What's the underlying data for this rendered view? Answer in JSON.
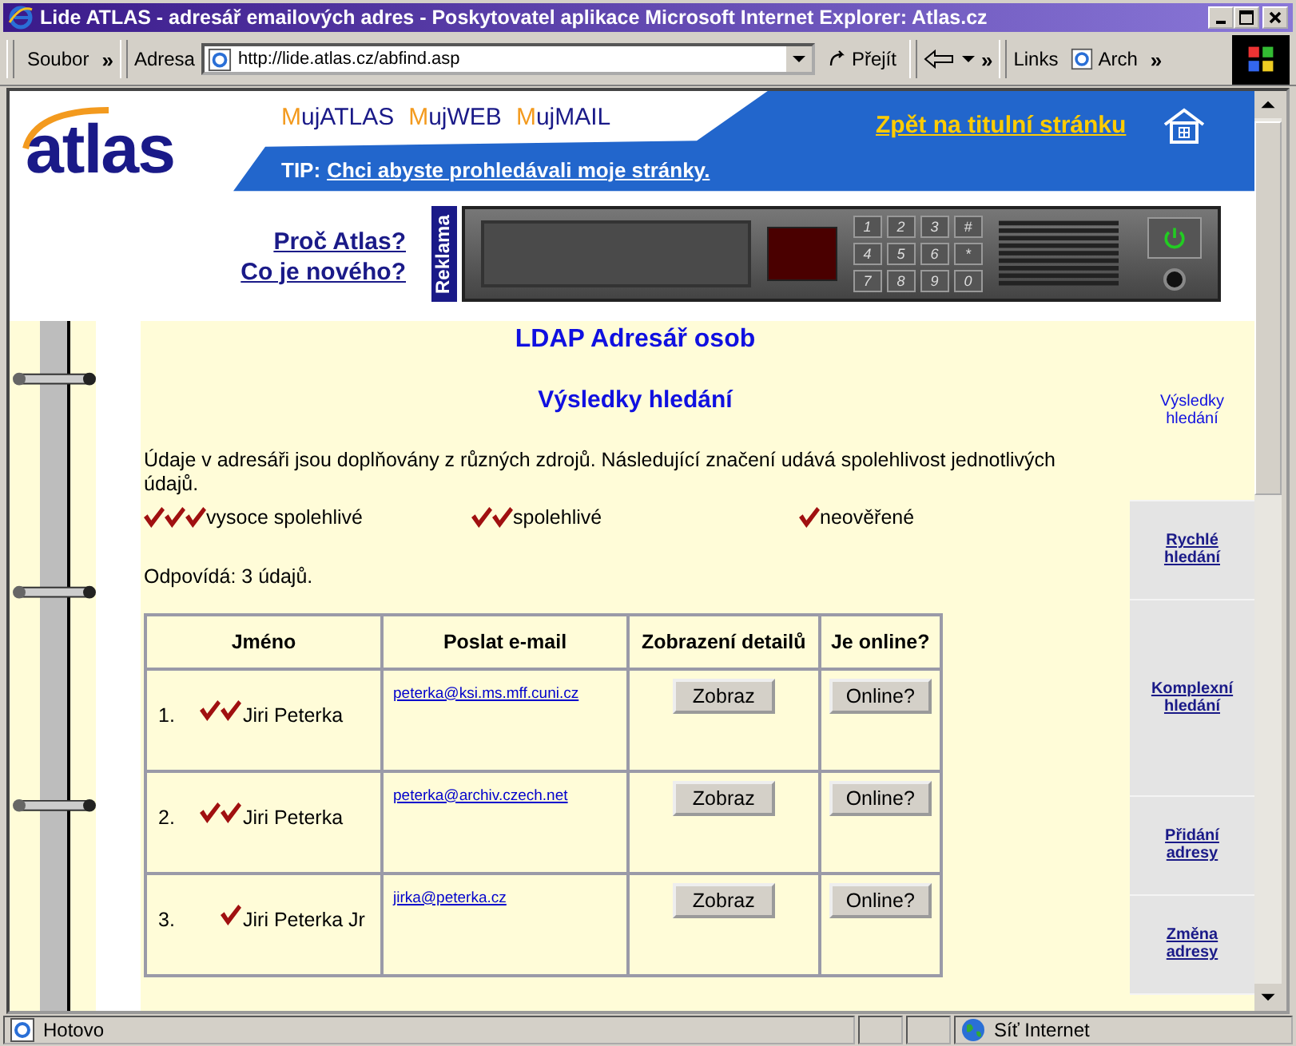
{
  "window": {
    "title": "Lide ATLAS - adresář emailových adres - Poskytovatel aplikace Microsoft Internet Explorer: Atlas.cz"
  },
  "toolbar": {
    "menu": "Soubor",
    "more": "»",
    "address_label": "Adresa",
    "url": "http://lide.atlas.cz/abfind.asp",
    "go": "Přejít",
    "more2": "»",
    "links": "Links",
    "link_item": "Arch",
    "more3": "»"
  },
  "header": {
    "logo": "atlas",
    "nav": [
      "MujATLAS",
      "MujWEB",
      "MujMAIL"
    ],
    "tip_label": "TIP:",
    "tip_link": "Chci abyste prohledávali moje stránky.",
    "home_link": "Zpět na titulní stránku"
  },
  "promo": {
    "links": [
      "Proč Atlas?",
      "Co je nového?"
    ],
    "ad_label": "Reklama",
    "keys": [
      "1",
      "2",
      "3",
      "#",
      "4",
      "5",
      "6",
      "*",
      "7",
      "8",
      "9",
      "0"
    ]
  },
  "content": {
    "title": "LDAP Adresář osob",
    "subtitle": "Výsledky hledání",
    "intro": "Údaje v adresáři jsou doplňovány z různých zdrojů. Následující značení udává spolehlivost jednotlivých údajů.",
    "legend": [
      {
        "kind": "high",
        "label": "vysoce spolehlivé"
      },
      {
        "kind": "medium",
        "label": "spolehlivé"
      },
      {
        "kind": "unverified",
        "label": "neověřené"
      }
    ],
    "count": "Odpovídá: 3 údajů.",
    "table": {
      "columns": [
        "Jméno",
        "Poslat e-mail",
        "Zobrazení detailů",
        "Je online?"
      ],
      "rows": [
        {
          "number": "1.",
          "kind": "medium",
          "name": "Jiri Peterka",
          "email": "peterka@ksi.ms.mff.cuni.cz",
          "detail_button": "Zobraz",
          "online_button": "Online?"
        },
        {
          "number": "2.",
          "kind": "medium",
          "name": "Jiri Peterka",
          "email": "peterka@archiv.czech.net",
          "detail_button": "Zobraz",
          "online_button": "Online?"
        },
        {
          "number": "3.",
          "kind": "unverified",
          "name": "Jiri Peterka Jr",
          "email": "jirka@peterka.cz",
          "detail_button": "Zobraz",
          "online_button": "Online?"
        }
      ]
    }
  },
  "sidebar": {
    "items": [
      {
        "label": "Výsledky hledání",
        "selected": true
      },
      {
        "label": "Rychlé hledání",
        "selected": false
      },
      {
        "label": "Komplexní hledání",
        "selected": false
      },
      {
        "label": "Přidání adresy",
        "selected": false
      },
      {
        "label": "Změna adresy",
        "selected": false
      }
    ]
  },
  "status_bar": {
    "text": "Hotovo",
    "zone": "Síť Internet"
  }
}
